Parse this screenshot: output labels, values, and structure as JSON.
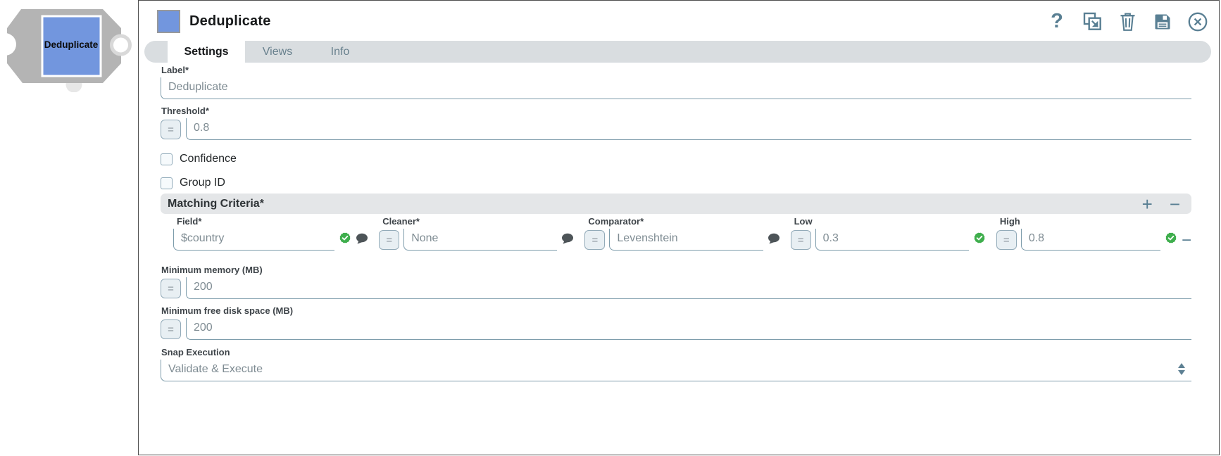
{
  "canvas": {
    "snap_label": "Deduplicate"
  },
  "dialog": {
    "title": "Deduplicate",
    "expression_toggle_label": "=",
    "toolbar": {
      "help_label": "?",
      "icons": [
        "help-icon",
        "popout-icon",
        "delete-icon",
        "save-icon",
        "close-icon"
      ]
    },
    "tabs": [
      {
        "label": "Settings",
        "active": true
      },
      {
        "label": "Views",
        "active": false
      },
      {
        "label": "Info",
        "active": false
      }
    ],
    "fields": {
      "label": {
        "label": "Label*",
        "value": "Deduplicate"
      },
      "threshold": {
        "label": "Threshold*",
        "value": "0.8"
      },
      "confidence": {
        "label": "Confidence",
        "checked": false
      },
      "group_id": {
        "label": "Group ID",
        "checked": false
      },
      "minimum_memory": {
        "label": "Minimum memory (MB)",
        "value": "200"
      },
      "minimum_free_disk_space": {
        "label": "Minimum free disk space (MB)",
        "value": "200"
      },
      "snap_execution": {
        "label": "Snap Execution",
        "value": "Validate & Execute"
      }
    },
    "matching_criteria": {
      "title": "Matching Criteria*",
      "add_label": "+",
      "remove_label": "−",
      "columns": [
        {
          "label": "Field*"
        },
        {
          "label": "Cleaner*"
        },
        {
          "label": "Comparator*"
        },
        {
          "label": "Low"
        },
        {
          "label": "High"
        }
      ],
      "row": {
        "field": "$country",
        "cleaner": "None",
        "comparator": "Levenshtein",
        "low": "0.3",
        "high": "0.8",
        "row_remove_label": "−"
      }
    },
    "colors": {
      "accent_slate": "#597f93",
      "input_border": "#7d9cab",
      "snap_blue": "#7296de",
      "valid_green": "#3fae4d"
    }
  }
}
